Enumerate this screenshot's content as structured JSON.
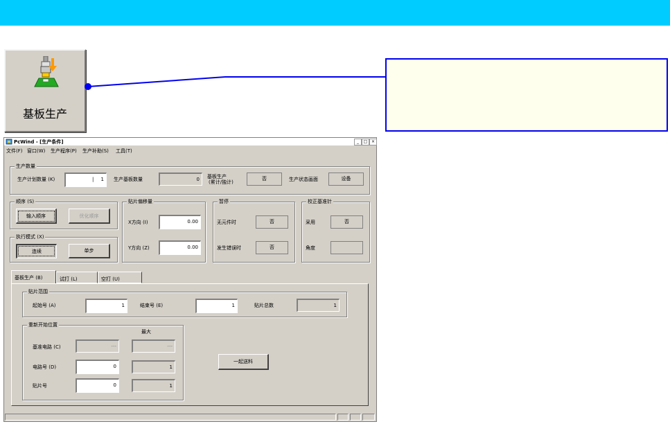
{
  "big_button": {
    "label": "基板生产"
  },
  "window": {
    "title": "PcWind - [生产条件]",
    "controls": {
      "minimize": "_",
      "restore": "□",
      "close": "×"
    }
  },
  "menu": [
    {
      "label": "文件(F)"
    },
    {
      "label": "窗口(W)"
    },
    {
      "label": "生产程序(P)"
    },
    {
      "label": "生产补助(S)"
    },
    {
      "label": "工具(T)"
    }
  ],
  "production_qty": {
    "title": "生产数量",
    "plan_label": "生产计划数量 (K)",
    "plan_value": "1",
    "board_count_label": "生产基板数量",
    "board_count_value": "0",
    "base_prod_label_1": "基板生产",
    "base_prod_label_2": "(累计/独计)",
    "base_prod_value": "否",
    "status_screen_label": "生产状态画面",
    "status_screen_value": "设备"
  },
  "order": {
    "title": "顺序 (S)",
    "input_order_button": "输入顺序",
    "optimize_button": "优化顺序"
  },
  "exec_mode": {
    "title": "执行模式 (X)",
    "continuous_button": "连续",
    "single_step_button": "单步"
  },
  "offset": {
    "title": "贴片偏移量",
    "x_label": "X方向 (I)",
    "x_value": "0.00",
    "y_label": "Y方向 (Z)",
    "y_value": "0.00"
  },
  "pause": {
    "title": "暂停",
    "no_part_label": "无元件时",
    "no_part_value": "否",
    "error_label": "发生错误时",
    "error_value": "否"
  },
  "correction": {
    "title": "校正基准针",
    "use_label": "采用",
    "use_value": "否",
    "angle_label": "角度",
    "angle_value": ""
  },
  "tabs": [
    {
      "label": "基板生产 (B)"
    },
    {
      "label": "试打 (L)"
    },
    {
      "label": "空打 (U)"
    }
  ],
  "mount_range": {
    "title": "贴片范围",
    "start_label": "起始号 (A)",
    "start_value": "1",
    "end_label": "结束号 (E)",
    "end_value": "1",
    "total_label": "贴片总数",
    "total_value": "1"
  },
  "restart": {
    "title": "重新开始位置",
    "max_header": "最大",
    "base_circuit_label": "基准电路 (C)",
    "base_circuit_value": "---",
    "base_circuit_max": "---",
    "circuit_label": "电路号 (D)",
    "circuit_value": "0",
    "circuit_max": "1",
    "mount_no_label": "贴片号",
    "mount_no_value": "0",
    "mount_no_max": "1",
    "feed_button": "一起送料"
  }
}
